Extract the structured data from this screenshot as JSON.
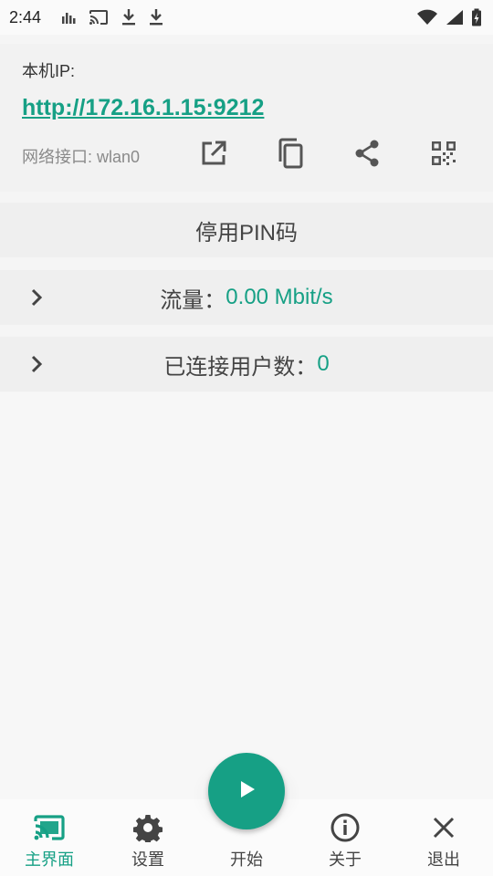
{
  "status_bar": {
    "time": "2:44",
    "left_icons": [
      "bar-chart-icon",
      "cast-icon",
      "download-icon",
      "download-icon"
    ],
    "right_icons": [
      "wifi-icon",
      "signal-icon",
      "battery-charging-icon"
    ]
  },
  "ip_card": {
    "label": "本机IP:",
    "url": "http://172.16.1.15:9212",
    "interface": "网络接口: wlan0",
    "actions": [
      "open-external-icon",
      "copy-icon",
      "share-icon",
      "qr-code-icon"
    ]
  },
  "rows": {
    "pin": {
      "label": "停用PIN码"
    },
    "flow": {
      "label": "流量：",
      "value": "0.00 Mbit/s"
    },
    "users": {
      "label": "已连接用户数：",
      "value": "0"
    }
  },
  "bottom_nav": {
    "items": [
      {
        "label": "主界面",
        "icon": "cast-icon",
        "active": true
      },
      {
        "label": "设置",
        "icon": "gear-icon",
        "active": false
      },
      {
        "label": "开始",
        "icon": "play-icon",
        "active": false
      },
      {
        "label": "关于",
        "icon": "info-icon",
        "active": false
      },
      {
        "label": "退出",
        "icon": "close-icon",
        "active": false
      }
    ]
  },
  "colors": {
    "accent": "#16a085",
    "background": "#f5f5f5",
    "card": "#efefef"
  }
}
